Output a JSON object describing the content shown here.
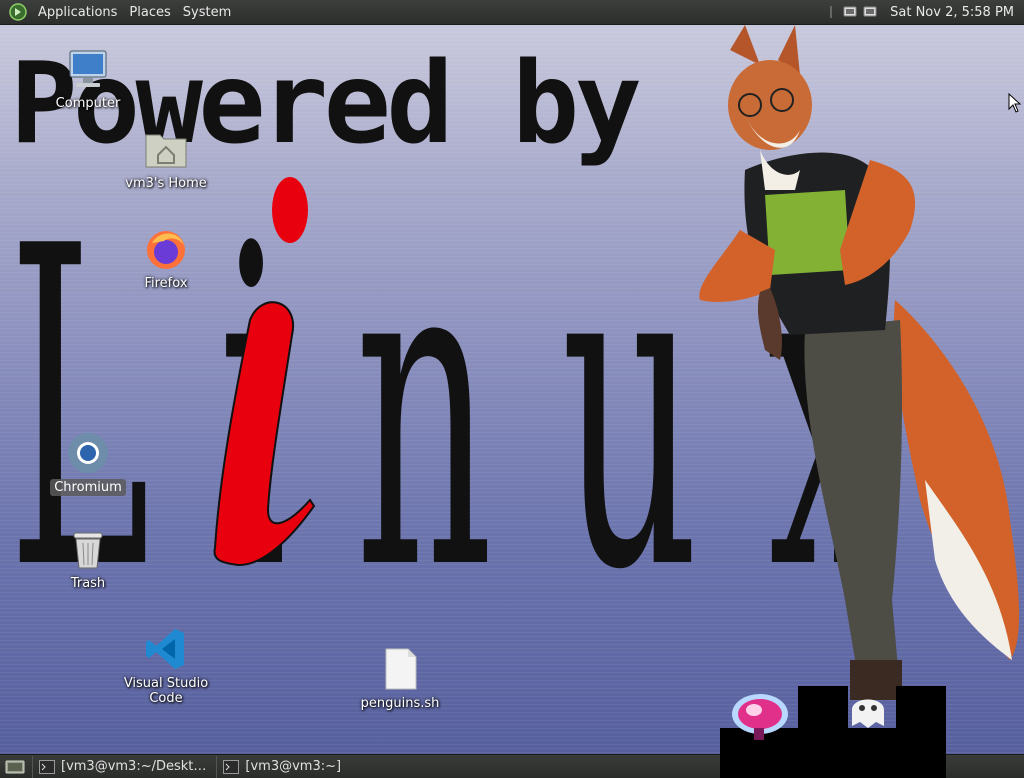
{
  "top_panel": {
    "menus": [
      "Applications",
      "Places",
      "System"
    ],
    "clock": "Sat Nov 2,  5:58 PM"
  },
  "wallpaper": {
    "headline": "Powered by",
    "logo_text": "L i n u x"
  },
  "desktop_icons": {
    "computer": "Computer",
    "home": "vm3's Home",
    "firefox": "Firefox",
    "chromium": "Chromium",
    "trash": "Trash",
    "vscode": "Visual Studio Code",
    "script": "penguins.sh"
  },
  "taskbar": {
    "tasks": [
      "[vm3@vm3:~/Deskt…",
      "[vm3@vm3:~]"
    ]
  },
  "colors": {
    "panel": "#2e302e",
    "logo_red": "#e8000f",
    "linux_letters": "#111111"
  }
}
